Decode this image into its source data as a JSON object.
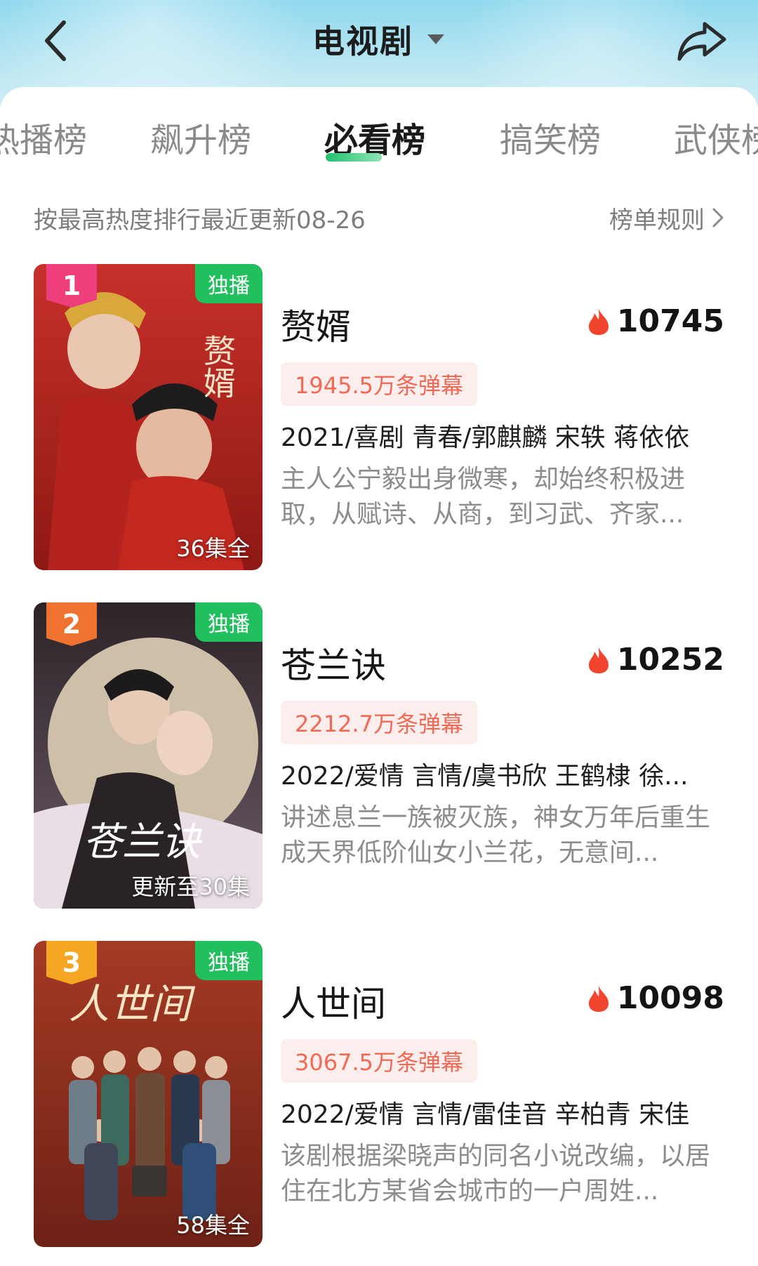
{
  "header": {
    "title": "电视剧",
    "back_icon": "chevron-left-icon",
    "dropdown_icon": "caret-down-icon",
    "share_icon": "share-icon"
  },
  "tabs": [
    {
      "label": "热播榜",
      "active": false
    },
    {
      "label": "飙升榜",
      "active": false
    },
    {
      "label": "必看榜",
      "active": true
    },
    {
      "label": "搞笑榜",
      "active": false
    },
    {
      "label": "武侠榜",
      "active": false
    }
  ],
  "subheader": {
    "info": "按最高热度排行最近更新08-26",
    "rules_label": "榜单规则"
  },
  "colors": {
    "accent_green": "#22bf5e",
    "rank1": "#ee3f7c",
    "rank2": "#f0722f",
    "rank3": "#f5a623",
    "danmu_text": "#f06a55",
    "heat_flame": "#f2452e"
  },
  "items": [
    {
      "rank": "1",
      "badge": "独播",
      "episodes": "36集全",
      "title": "赘婿",
      "heat": "10745",
      "danmu": "1945.5万条弹幕",
      "meta": "2021/喜剧 青春/郭麒麟 宋轶 蒋依依",
      "desc": "主人公宁毅出身微寒，却始终积极进取，从赋诗、从商，到习武、齐家...",
      "poster_text": "赘婿"
    },
    {
      "rank": "2",
      "badge": "独播",
      "episodes": "更新至30集",
      "title": "苍兰诀",
      "heat": "10252",
      "danmu": "2212.7万条弹幕",
      "meta": "2022/爱情 言情/虞书欣 王鹤棣 徐...",
      "desc": "讲述息兰一族被灭族，神女万年后重生成天界低阶仙女小兰花，无意间...",
      "poster_text": "苍兰诀"
    },
    {
      "rank": "3",
      "badge": "独播",
      "episodes": "58集全",
      "title": "人世间",
      "heat": "10098",
      "danmu": "3067.5万条弹幕",
      "meta": "2022/爱情 言情/雷佳音 辛柏青 宋佳",
      "desc": "该剧根据梁晓声的同名小说改编，以居住在北方某省会城市的一户周姓...",
      "poster_text": "人世间"
    }
  ]
}
